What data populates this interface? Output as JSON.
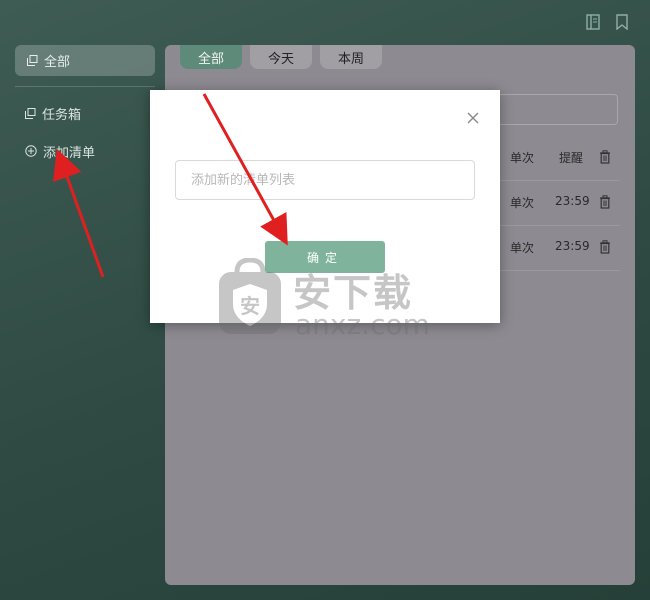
{
  "header": {
    "icons": [
      "notebook-icon",
      "bookmark-icon"
    ]
  },
  "sidebar": {
    "all_label": "全部",
    "items": [
      {
        "label": "任务箱",
        "icon": "copy-icon"
      },
      {
        "label": "添加清单",
        "icon": "plus-circle-icon"
      }
    ]
  },
  "tabs": [
    {
      "label": "全部",
      "active": true
    },
    {
      "label": "今天",
      "active": false
    },
    {
      "label": "本周",
      "active": false
    }
  ],
  "tasks": {
    "header": {
      "repeat": "单次",
      "reminder": "提醒"
    },
    "rows": [
      {
        "repeat": "单次",
        "time": "23:59"
      },
      {
        "repeat": "单次",
        "time": "23:59"
      }
    ]
  },
  "modal": {
    "input_placeholder": "添加新的清单列表",
    "input_value": "",
    "ok_label": "确定"
  },
  "watermark": {
    "title": "安下载",
    "subtitle": "anxz.com",
    "shield_char": "安"
  },
  "colors": {
    "accent": "#5e8b79",
    "button": "#80b39b",
    "arrow": "#e02020"
  }
}
